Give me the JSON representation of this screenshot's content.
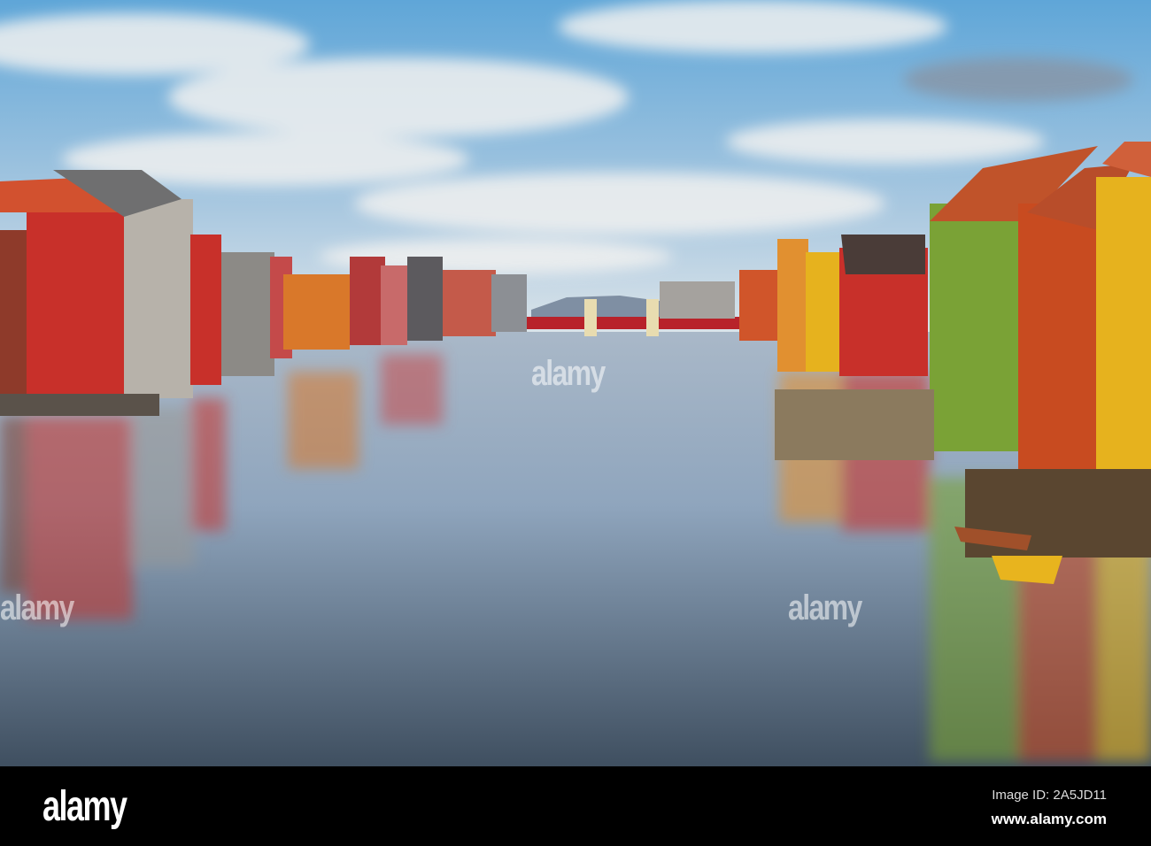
{
  "photo": {
    "subject": "colorful wharf houses along a river",
    "colors": {
      "sky_top": "#4f9fd6",
      "sky_low": "#cfdde8",
      "water": "#7d94ad",
      "red": "#c8302a",
      "orange": "#d9782a",
      "yellow": "#e6b21e",
      "green": "#7aa236",
      "grey": "#8c8a86"
    }
  },
  "watermark": {
    "text": "alamy"
  },
  "footer": {
    "logo": "alamy",
    "image_id": "Image ID: 2A5JD11",
    "website": "www.alamy.com"
  }
}
